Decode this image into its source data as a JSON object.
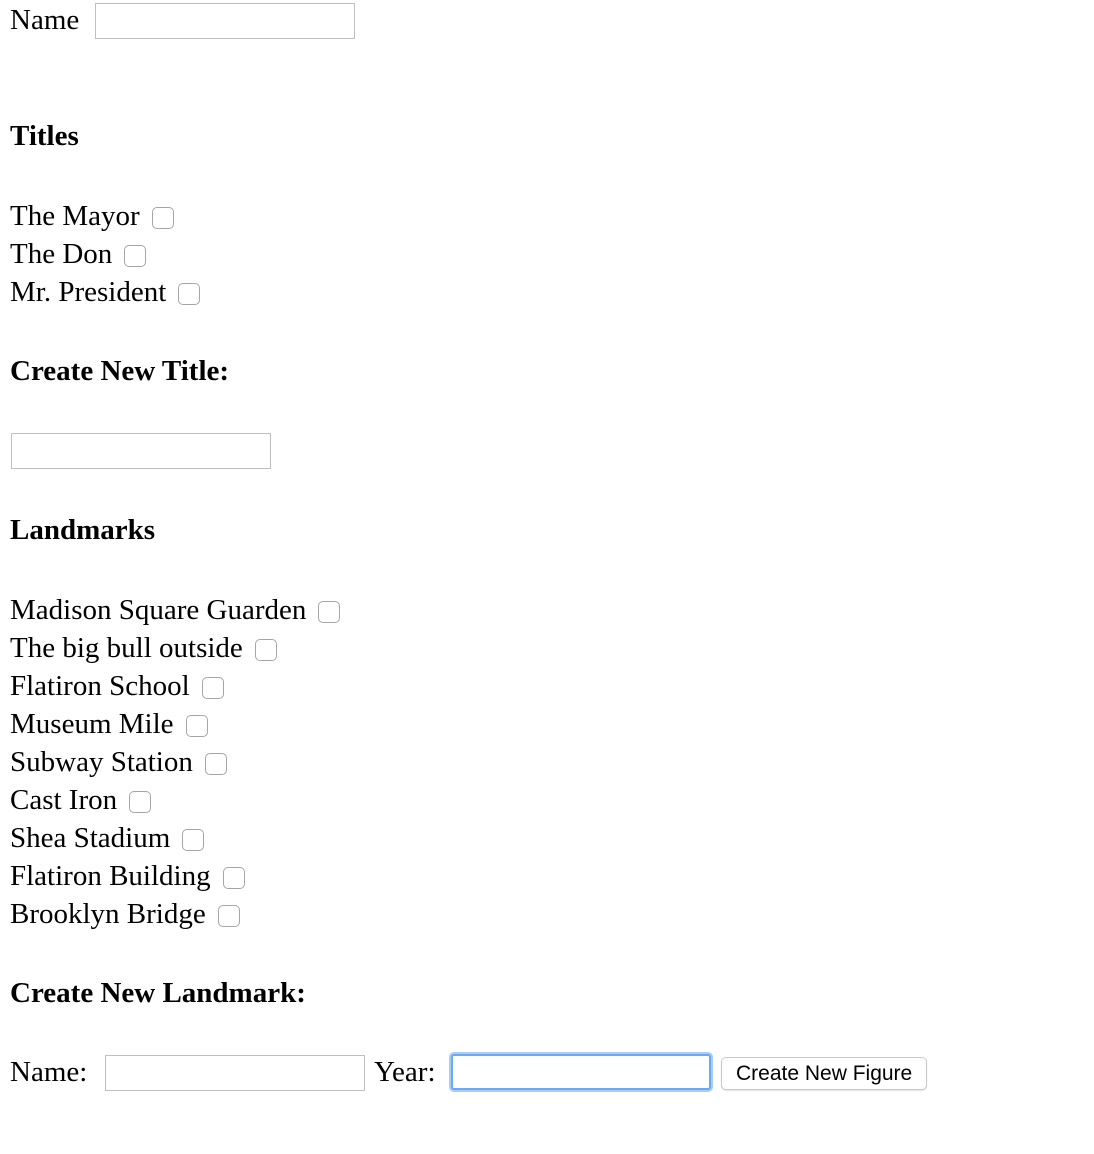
{
  "name_field": {
    "label": "Name",
    "value": "",
    "placeholder": ""
  },
  "titles": {
    "heading": "Titles",
    "items": [
      {
        "label": "The Mayor",
        "checked": false
      },
      {
        "label": "The Don",
        "checked": false
      },
      {
        "label": "Mr. President",
        "checked": false
      }
    ]
  },
  "create_title": {
    "heading": "Create New Title:",
    "value": "",
    "placeholder": ""
  },
  "landmarks": {
    "heading": "Landmarks",
    "items": [
      {
        "label": "Madison Square Guarden",
        "checked": false
      },
      {
        "label": "The big bull outside",
        "checked": false
      },
      {
        "label": "Flatiron School",
        "checked": false
      },
      {
        "label": "Museum Mile",
        "checked": false
      },
      {
        "label": "Subway Station",
        "checked": false
      },
      {
        "label": "Cast Iron",
        "checked": false
      },
      {
        "label": "Shea Stadium",
        "checked": false
      },
      {
        "label": "Flatiron Building",
        "checked": false
      },
      {
        "label": "Brooklyn Bridge",
        "checked": false
      }
    ]
  },
  "create_landmark": {
    "heading": "Create New Landmark:",
    "name_label": "Name:",
    "name_value": "",
    "year_label": "Year:",
    "year_value": "",
    "submit_label": "Create New Figure"
  },
  "colors": {
    "focus_ring": "#6aa9f3",
    "input_border": "#bfbfbf"
  }
}
